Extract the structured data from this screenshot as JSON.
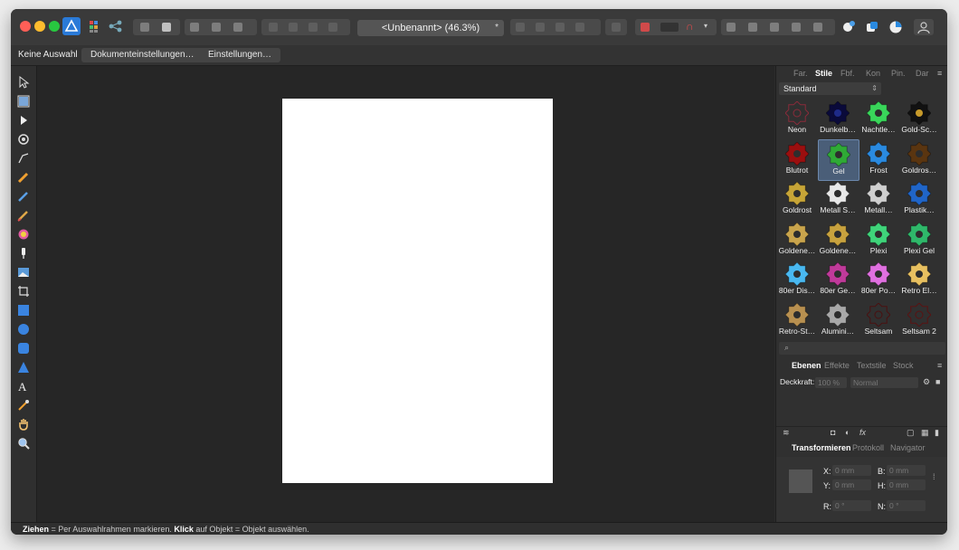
{
  "window": {
    "document_title": "<Unbenannt> (46.3%)",
    "modified_marker": "*"
  },
  "context_toolbar": {
    "selection_label": "Keine Auswahl",
    "document_settings_label": "Dokumenteinstellungen…",
    "preferences_label": "Einstellungen…"
  },
  "tools": [
    "move-tool-icon",
    "artboard-tool-icon",
    "node-tool-icon",
    "corner-tool-icon",
    "pen-tool-icon",
    "pencil-tool-icon",
    "vector-brush-icon",
    "paint-brush-icon",
    "fill-tool-icon",
    "transparency-tool-icon",
    "place-image-icon",
    "crop-tool-icon",
    "rectangle-tool-icon",
    "ellipse-tool-icon",
    "rounded-rect-icon",
    "triangle-tool-icon",
    "text-tool-icon",
    "color-picker-icon",
    "hand-tool-icon",
    "zoom-tool-icon"
  ],
  "styles_panel": {
    "tabs": [
      "Far.",
      "Stile",
      "Fbf.",
      "Kon",
      "Pin.",
      "Dar"
    ],
    "active_tab": "Stile",
    "category": "Standard",
    "search_placeholder": "",
    "items": [
      {
        "label": "Neon",
        "color": "#8a2b3a",
        "outline": true
      },
      {
        "label": "Dunkelb…",
        "color": "#0a0a3a",
        "ring": "#1e2a88"
      },
      {
        "label": "Nachtle…",
        "color": "#39d65a"
      },
      {
        "label": "Gold-Sc…",
        "color": "#111111",
        "ring": "#c79a2a"
      },
      {
        "label": "Blutrot",
        "color": "#9b0f0f"
      },
      {
        "label": "Gel",
        "color": "#2faa36",
        "selected": true
      },
      {
        "label": "Frost",
        "color": "#2a8ae0"
      },
      {
        "label": "Goldros…",
        "color": "#5a3510"
      },
      {
        "label": "Goldrost",
        "color": "#c7a537"
      },
      {
        "label": "Metall S…",
        "color": "#e8e8e8"
      },
      {
        "label": "Metall…",
        "color": "#cfcfcf"
      },
      {
        "label": "Plastik…",
        "color": "#2065c8"
      },
      {
        "label": "Goldene…",
        "color": "#c9a44c"
      },
      {
        "label": "Goldene…",
        "color": "#c8a23e"
      },
      {
        "label": "Plexi",
        "color": "#3fd47a"
      },
      {
        "label": "Plexi Gel",
        "color": "#2fb86a"
      },
      {
        "label": "80er Dis…",
        "color": "#49b8f0"
      },
      {
        "label": "80er Ge…",
        "color": "#c03a9a"
      },
      {
        "label": "80er Po…",
        "color": "#e070e0"
      },
      {
        "label": "Retro El…",
        "color": "#e8c060"
      },
      {
        "label": "Retro-St…",
        "color": "#b89050"
      },
      {
        "label": "Alumini…",
        "color": "#a8a8a8"
      },
      {
        "label": "Seltsam",
        "color": "#4a1010",
        "outline": true
      },
      {
        "label": "Seltsam 2",
        "color": "#5a1212",
        "outline": true
      }
    ]
  },
  "layers_panel": {
    "tabs": [
      "Ebenen",
      "Effekte",
      "Textstile",
      "Stock"
    ],
    "active_tab": "Ebenen",
    "opacity_label": "Deckkraft:",
    "opacity_value": "100 %",
    "blend_mode": "Normal"
  },
  "transform_panel": {
    "tabs": [
      "Transformieren",
      "Protokoll",
      "Navigator"
    ],
    "active_tab": "Transformieren",
    "x_label": "X:",
    "x_value": "0 mm",
    "y_label": "Y:",
    "y_value": "0 mm",
    "b_label": "B:",
    "b_value": "0 mm",
    "h_label": "H:",
    "h_value": "0 mm",
    "r_label": "R:",
    "r_value": "0 °",
    "n_label": "N:",
    "n_value": "0 °"
  },
  "status": {
    "drag_word": "Ziehen",
    "drag_text": " = Per Auswahlrahmen markieren. ",
    "click_word": "Klick",
    "click_text": " auf Objekt = Objekt auswählen."
  }
}
